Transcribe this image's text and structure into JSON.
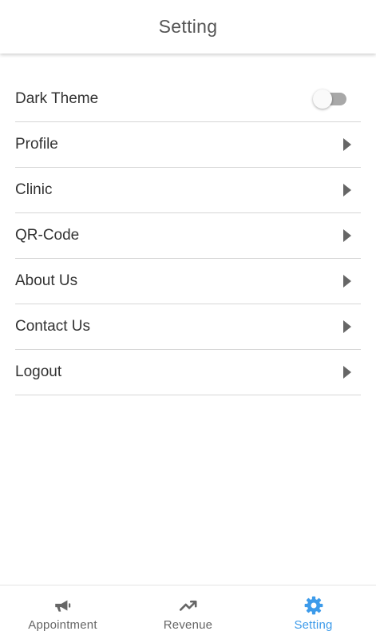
{
  "header": {
    "title": "Setting"
  },
  "settings": {
    "dark_theme": {
      "label": "Dark Theme",
      "enabled": false
    },
    "items": [
      {
        "label": "Profile"
      },
      {
        "label": "Clinic"
      },
      {
        "label": "QR-Code"
      },
      {
        "label": "About Us"
      },
      {
        "label": "Contact Us"
      },
      {
        "label": "Logout"
      }
    ]
  },
  "bottom_nav": {
    "items": [
      {
        "label": "Appointment",
        "icon": "megaphone-icon",
        "active": false
      },
      {
        "label": "Revenue",
        "icon": "trending-up-icon",
        "active": false
      },
      {
        "label": "Setting",
        "icon": "gear-icon",
        "active": true
      }
    ]
  },
  "colors": {
    "accent": "#3d9bea",
    "inactive": "#666666",
    "divider": "#d6d6d6"
  }
}
